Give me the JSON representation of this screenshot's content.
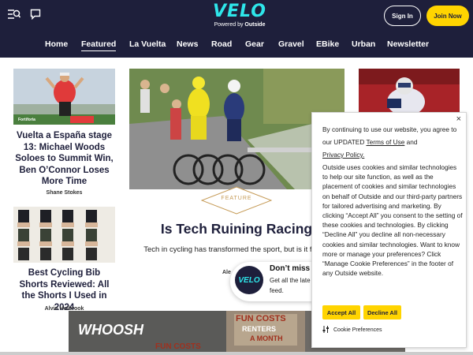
{
  "header": {
    "logo_text": "VELO",
    "logo_sub_prefix": "Powered by",
    "logo_sub_brand": "Outside",
    "signin_label": "Sign In",
    "join_label": "Join Now",
    "icons": [
      "menu-search-icon",
      "chat-icon"
    ]
  },
  "nav": {
    "items": [
      "Home",
      "Featured",
      "La Vuelta",
      "News",
      "Road",
      "Gear",
      "Gravel",
      "EBike",
      "Urban",
      "Newsletter"
    ],
    "active": "Featured"
  },
  "stories": {
    "left1": {
      "title": "Vuelta a España stage 13: Michael Woods Soloes to Summit Win, Ben O’Connor Loses More Time",
      "author": "Shane Stokes",
      "image_caption": "Fortiforia"
    },
    "left2": {
      "title": "Best Cycling Bib Shorts Reviewed: All the Shorts I Used in 2024",
      "author": "Alvin Holbrook"
    },
    "main": {
      "badge": "FEATURE",
      "title": "Is Tech Ruining Racing",
      "dek": "Tech in cycling has transformed the sport, but is it for the b",
      "author": "Ale"
    }
  },
  "newsletter_popup": {
    "logo_text": "VELO",
    "title": "Don’t miss n",
    "text": "Get all the late feed."
  },
  "ad": {
    "brand": "WHOOSH",
    "headline1": "FUN COSTS",
    "headline2": "FUN COSTS",
    "sub": "RENTERS",
    "sub2": "A MONTH"
  },
  "cookie": {
    "close": "×",
    "p1_pre": "By continuing to use our website, you agree to our UPDATED",
    "terms_link": "Terms of Use",
    "p1_mid": "and",
    "privacy_link": "Privacy Policy.",
    "p2": "Outside uses cookies and similar technologies to help our site function, as well as the placement of cookies and similar technologies on behalf of Outside and our third-party partners for tailored advertising and marketing. By clicking “Accept All” you consent to the setting of these cookies and technologies. By clicking “Decline All” you decline all non-necessary cookies and similar technologies. Want to know more or manage your preferences? Click “Manage Cookie Preferences” in the footer of any Outside website.",
    "accept_label": "Accept All",
    "decline_label": "Decline All",
    "pref_label": "Cookie Preferences"
  },
  "colors": {
    "navy": "#1e1f3b",
    "cyan": "#2ee6ea",
    "yellow": "#ffd400",
    "gold": "#c59a55"
  }
}
